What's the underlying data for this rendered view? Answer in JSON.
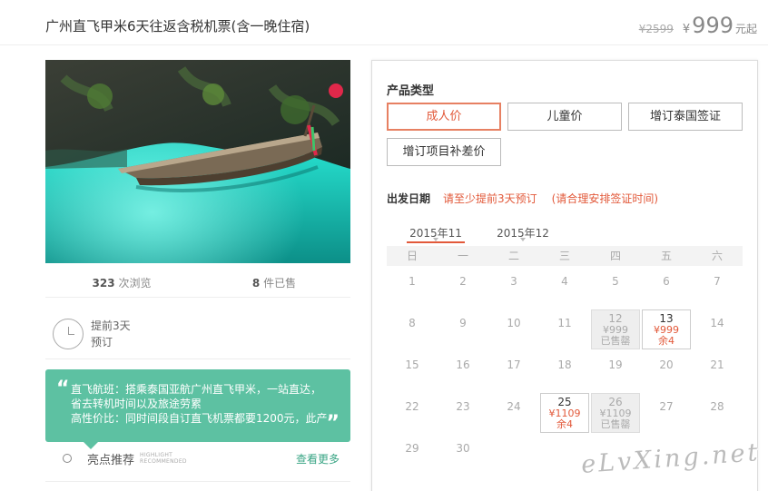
{
  "header": {
    "title": "广州直飞甲米6天往返含税机票(含一晚住宿)",
    "original_price": "¥2599",
    "currency": "¥",
    "price": "999",
    "price_suffix": "元起"
  },
  "stats": {
    "views_count": "323",
    "views_label": "次浏览",
    "sold_count": "8",
    "sold_label": "件已售"
  },
  "advance": {
    "line1": "提前3天",
    "line2": "预订"
  },
  "highlight": {
    "open_quote": "“",
    "close_quote": "”",
    "lines": [
      "直飞航班：搭乘泰国亚航广州直飞甲米，一站直达，",
      "省去转机时间以及旅途劳累",
      "高性价比：同时间段自订直飞机票都要1200元，此产"
    ],
    "label": "亮点推荐",
    "label_en_1": "HIGHLIGHT",
    "label_en_2": "RECOMMENDED",
    "see_more": "查看更多"
  },
  "panel": {
    "product_type_label": "产品类型",
    "options": [
      "成人价",
      "儿童价",
      "增订泰国签证",
      "增订项目补差价"
    ],
    "date_label": "出发日期",
    "date_note1": "请至少提前3天预订",
    "date_note2": "(请合理安排签证时间)",
    "months": [
      "2015年11",
      "2015年12"
    ],
    "weekdays": [
      "日",
      "一",
      "二",
      "三",
      "四",
      "五",
      "六"
    ],
    "calendar": [
      [
        {
          "d": "1"
        },
        {
          "d": "2"
        },
        {
          "d": "3"
        },
        {
          "d": "4"
        },
        {
          "d": "5"
        },
        {
          "d": "6"
        },
        {
          "d": "7"
        }
      ],
      [
        {
          "d": "8"
        },
        {
          "d": "9"
        },
        {
          "d": "10"
        },
        {
          "d": "11"
        },
        {
          "d": "12",
          "state": "full",
          "price": "¥999",
          "status": "已售罄"
        },
        {
          "d": "13",
          "state": "avail",
          "price": "¥999",
          "status": "余4"
        },
        {
          "d": "14"
        }
      ],
      [
        {
          "d": "15"
        },
        {
          "d": "16"
        },
        {
          "d": "17"
        },
        {
          "d": "18"
        },
        {
          "d": "19"
        },
        {
          "d": "20"
        },
        {
          "d": "21"
        }
      ],
      [
        {
          "d": "22"
        },
        {
          "d": "23"
        },
        {
          "d": "24"
        },
        {
          "d": "25",
          "state": "avail",
          "price": "¥1109",
          "status": "余4"
        },
        {
          "d": "26",
          "state": "full",
          "price": "¥1109",
          "status": "已售罄"
        },
        {
          "d": "27"
        },
        {
          "d": "28"
        }
      ],
      [
        {
          "d": "29"
        },
        {
          "d": "30"
        },
        {
          "d": ""
        },
        {
          "d": ""
        },
        {
          "d": ""
        },
        {
          "d": ""
        },
        {
          "d": ""
        }
      ]
    ]
  },
  "watermark": "eLvXing.net",
  "colors": {
    "accent": "#e2593a",
    "teal": "#5dc1a2",
    "link_green": "#3aa585"
  }
}
